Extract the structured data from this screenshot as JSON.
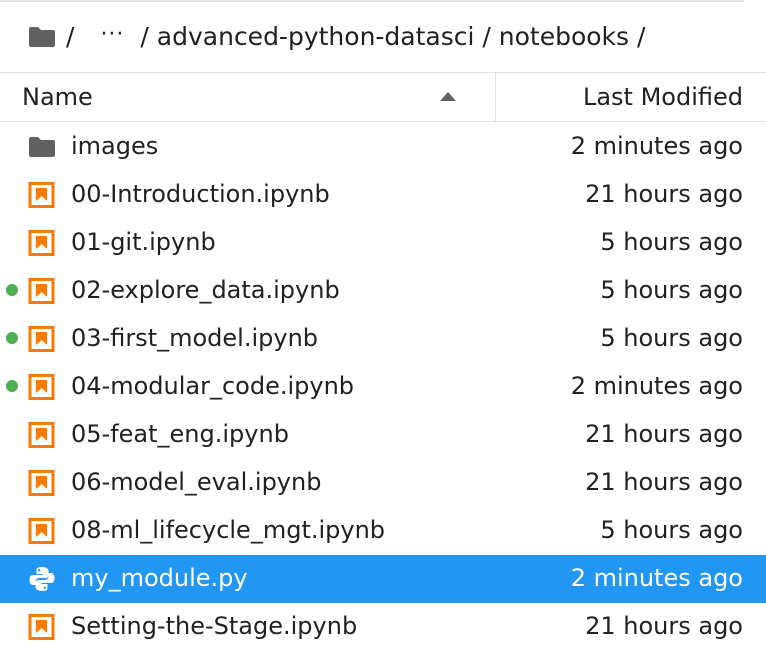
{
  "breadcrumb": {
    "root_separator": "/",
    "ellipsis": "···",
    "path": "/ advanced-python-datasci / notebooks /"
  },
  "header": {
    "name_label": "Name",
    "modified_label": "Last Modified"
  },
  "colors": {
    "notebook_orange": "#f57c00",
    "folder_gray": "#616161",
    "running_green": "#4caf50",
    "selected_blue": "#2196f3"
  },
  "files": [
    {
      "icon": "folder-icon",
      "name": "images",
      "modified": "2 minutes ago",
      "running": false,
      "selected": false
    },
    {
      "icon": "notebook-icon",
      "name": "00-Introduction.ipynb",
      "modified": "21 hours ago",
      "running": false,
      "selected": false
    },
    {
      "icon": "notebook-icon",
      "name": "01-git.ipynb",
      "modified": "5 hours ago",
      "running": false,
      "selected": false
    },
    {
      "icon": "notebook-icon",
      "name": "02-explore_data.ipynb",
      "modified": "5 hours ago",
      "running": true,
      "selected": false
    },
    {
      "icon": "notebook-icon",
      "name": "03-first_model.ipynb",
      "modified": "5 hours ago",
      "running": true,
      "selected": false
    },
    {
      "icon": "notebook-icon",
      "name": "04-modular_code.ipynb",
      "modified": "2 minutes ago",
      "running": true,
      "selected": false
    },
    {
      "icon": "notebook-icon",
      "name": "05-feat_eng.ipynb",
      "modified": "21 hours ago",
      "running": false,
      "selected": false
    },
    {
      "icon": "notebook-icon",
      "name": "06-model_eval.ipynb",
      "modified": "21 hours ago",
      "running": false,
      "selected": false
    },
    {
      "icon": "notebook-icon",
      "name": "08-ml_lifecycle_mgt.ipynb",
      "modified": "5 hours ago",
      "running": false,
      "selected": false
    },
    {
      "icon": "python-file-icon",
      "name": "my_module.py",
      "modified": "2 minutes ago",
      "running": false,
      "selected": true
    },
    {
      "icon": "notebook-icon",
      "name": "Setting-the-Stage.ipynb",
      "modified": "21 hours ago",
      "running": false,
      "selected": false
    }
  ]
}
